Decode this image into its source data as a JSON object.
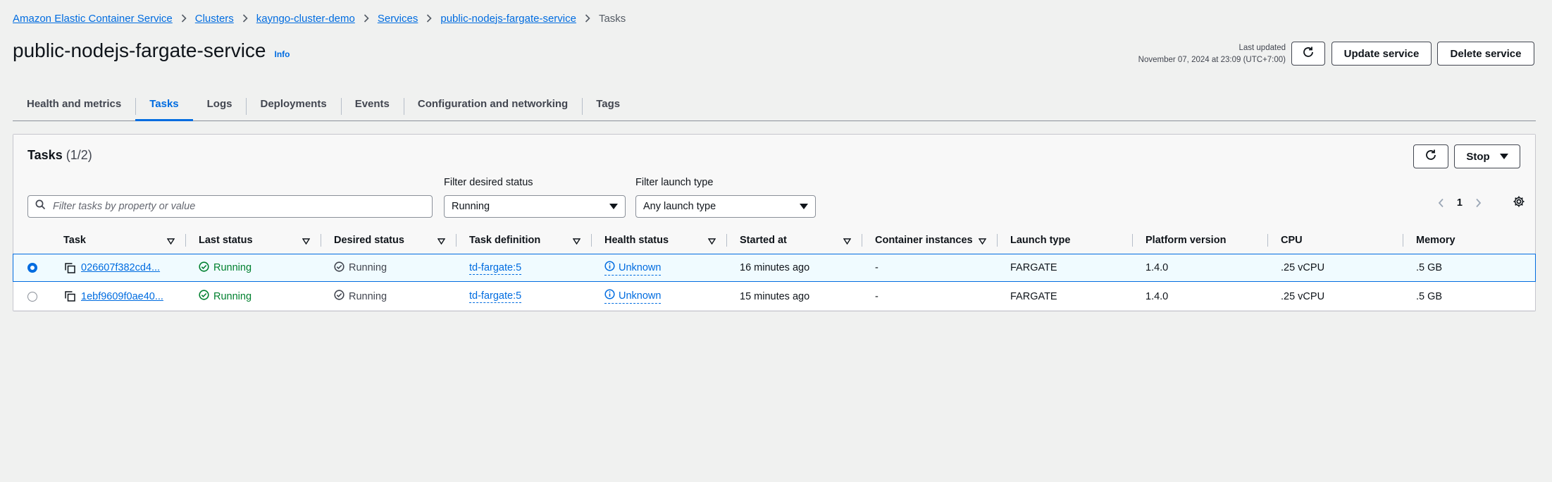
{
  "breadcrumb": [
    {
      "label": "Amazon Elastic Container Service"
    },
    {
      "label": "Clusters"
    },
    {
      "label": "kayngo-cluster-demo"
    },
    {
      "label": "Services"
    },
    {
      "label": "public-nodejs-fargate-service"
    }
  ],
  "breadcrumb_current": "Tasks",
  "page": {
    "title": "public-nodejs-fargate-service",
    "info": "Info",
    "last_updated_label": "Last updated",
    "last_updated_value": "November 07, 2024 at 23:09 (UTC+7:00)",
    "update_button": "Update service",
    "delete_button": "Delete service"
  },
  "tabs": [
    {
      "label": "Health and metrics"
    },
    {
      "label": "Tasks",
      "active": true
    },
    {
      "label": "Logs"
    },
    {
      "label": "Deployments"
    },
    {
      "label": "Events"
    },
    {
      "label": "Configuration and networking"
    },
    {
      "label": "Tags"
    }
  ],
  "tasks_panel": {
    "title": "Tasks",
    "count": "(1/2)",
    "stop_button": "Stop",
    "search_placeholder": "Filter tasks by property or value",
    "filter_status_label": "Filter desired status",
    "filter_status_value": "Running",
    "filter_launch_label": "Filter launch type",
    "filter_launch_value": "Any launch type",
    "page_number": "1"
  },
  "columns": {
    "task": "Task",
    "last_status": "Last status",
    "desired_status": "Desired status",
    "task_definition": "Task definition",
    "health_status": "Health status",
    "started_at": "Started at",
    "container_instances": "Container instances",
    "launch_type": "Launch type",
    "platform_version": "Platform version",
    "cpu": "CPU",
    "memory": "Memory"
  },
  "rows": [
    {
      "selected": true,
      "task": "026607f382cd4...",
      "last_status": "Running",
      "desired_status": "Running",
      "task_definition": "td-fargate:5",
      "health_status": "Unknown",
      "started_at": "16 minutes ago",
      "container_instances": "-",
      "launch_type": "FARGATE",
      "platform_version": "1.4.0",
      "cpu": ".25 vCPU",
      "memory": ".5 GB"
    },
    {
      "selected": false,
      "task": "1ebf9609f0ae40...",
      "last_status": "Running",
      "desired_status": "Running",
      "task_definition": "td-fargate:5",
      "health_status": "Unknown",
      "started_at": "15 minutes ago",
      "container_instances": "-",
      "launch_type": "FARGATE",
      "platform_version": "1.4.0",
      "cpu": ".25 vCPU",
      "memory": ".5 GB"
    }
  ],
  "colors": {
    "link": "#006ce0",
    "success": "#00802f",
    "selected_row_bg": "#f0fbff"
  }
}
